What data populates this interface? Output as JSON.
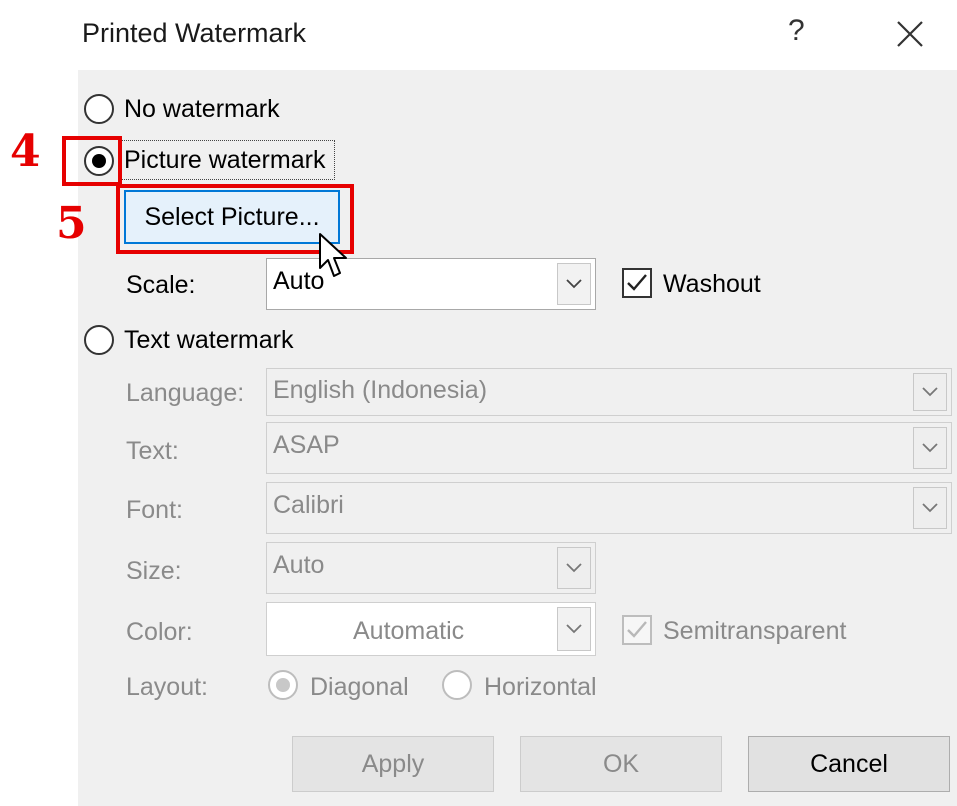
{
  "dialog": {
    "title": "Printed Watermark",
    "help_glyph": "?",
    "close_glyph": "✕"
  },
  "options": {
    "no_watermark": "No watermark",
    "picture_watermark": "Picture watermark",
    "text_watermark": "Text watermark",
    "selected": "picture_watermark"
  },
  "picture": {
    "select_button": "Select Picture...",
    "scale_label": "Scale:",
    "scale_value": "Auto",
    "washout_label": "Washout",
    "washout_checked": true
  },
  "text": {
    "language_label": "Language:",
    "language_value": "English (Indonesia)",
    "text_label": "Text:",
    "text_value": "ASAP",
    "font_label": "Font:",
    "font_value": "Calibri",
    "size_label": "Size:",
    "size_value": "Auto",
    "color_label": "Color:",
    "color_value": "Automatic",
    "semitransparent_label": "Semitransparent",
    "semitransparent_checked": true,
    "layout_label": "Layout:",
    "diagonal_label": "Diagonal",
    "horizontal_label": "Horizontal",
    "layout_selected": "diagonal"
  },
  "buttons": {
    "apply": "Apply",
    "ok": "OK",
    "cancel": "Cancel"
  },
  "annotations": {
    "step4": "4",
    "step5": "5",
    "color": "#e60000"
  }
}
